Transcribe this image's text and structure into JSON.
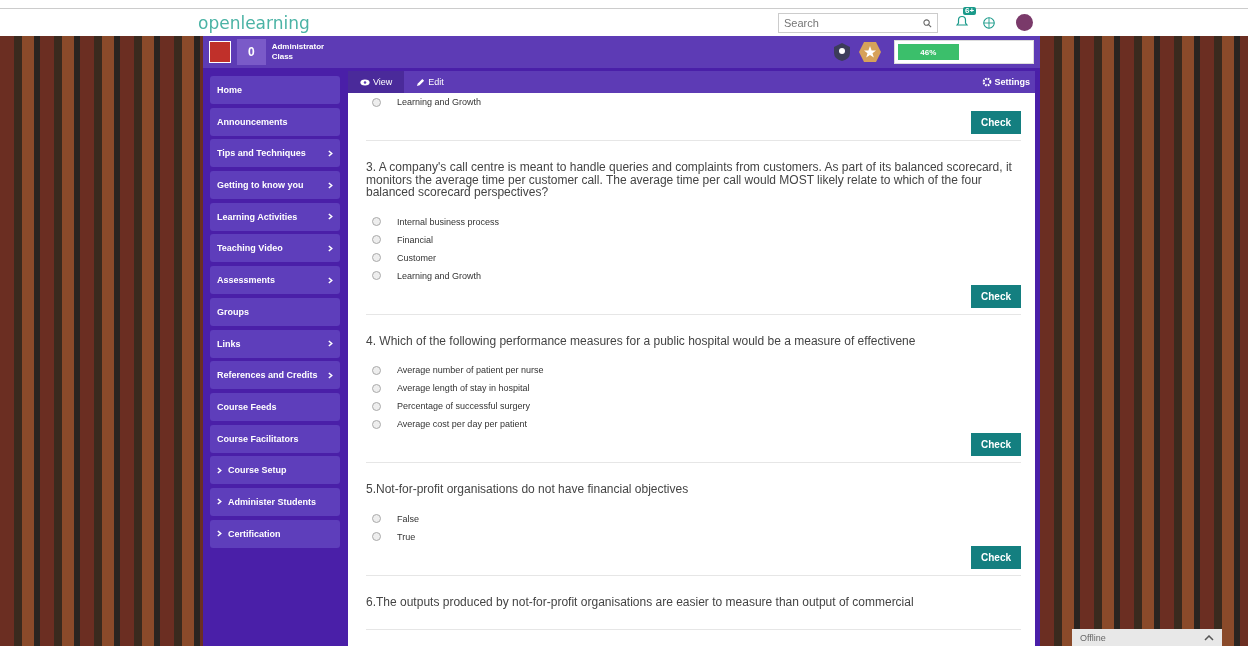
{
  "topbar": {
    "logo": "openlearning",
    "search": {
      "placeholder": "Search"
    },
    "notification_badge": "6+"
  },
  "course_header": {
    "points": "0",
    "role": "Administrator Class",
    "progress": {
      "level": 0.46,
      "label": "46%"
    }
  },
  "sidebar": {
    "items": [
      {
        "label": "Home",
        "expandable": false,
        "collapsible": false
      },
      {
        "label": "Announcements",
        "expandable": false,
        "collapsible": false
      },
      {
        "label": "Tips and Techniques",
        "expandable": true,
        "collapsible": false
      },
      {
        "label": "Getting to know you",
        "expandable": true,
        "collapsible": false
      },
      {
        "label": "Learning Activities",
        "expandable": true,
        "collapsible": false
      },
      {
        "label": "Teaching Video",
        "expandable": true,
        "collapsible": false
      },
      {
        "label": "Assessments",
        "expandable": true,
        "collapsible": false
      },
      {
        "label": "Groups",
        "expandable": false,
        "collapsible": false
      },
      {
        "label": "Links",
        "expandable": true,
        "collapsible": false
      },
      {
        "label": "References and Credits",
        "expandable": true,
        "collapsible": false
      },
      {
        "label": "Course Feeds",
        "expandable": false,
        "collapsible": false
      },
      {
        "label": "Course Facilitators",
        "expandable": false,
        "collapsible": false
      },
      {
        "label": "Course Setup",
        "expandable": false,
        "collapsible": true
      },
      {
        "label": "Administer Students",
        "expandable": false,
        "collapsible": true
      },
      {
        "label": "Certification",
        "expandable": false,
        "collapsible": true
      }
    ]
  },
  "tabs": [
    {
      "label": "View",
      "selected": true
    },
    {
      "label": "Edit",
      "selected": false
    }
  ],
  "settings": "Settings",
  "questions": [
    {
      "options": [
        {
          "label": "Learning and Growth",
          "selected": false
        }
      ],
      "button": "Check"
    },
    {
      "text": "3. A company's call centre is meant to handle queries and complaints from customers. As part of its balanced scorecard, it monitors the average time per customer call. The average time per call would MOST likely relate to which of the four balanced scorecard perspectives?",
      "options": [
        {
          "label": "Internal business process",
          "selected": false
        },
        {
          "label": "Financial",
          "selected": false
        },
        {
          "label": "Customer",
          "selected": false
        },
        {
          "label": "Learning and Growth",
          "selected": false
        }
      ],
      "button": "Check"
    },
    {
      "text": "4. Which of the following performance measures for a public hospital would be a measure of effectivene",
      "options": [
        {
          "label": "Average number of patient per nurse",
          "selected": false
        },
        {
          "label": "Average length of stay in hospital",
          "selected": false
        },
        {
          "label": "Percentage of successful surgery",
          "selected": false
        },
        {
          "label": "Average cost per day per patient",
          "selected": false
        }
      ],
      "button": "Check"
    },
    {
      "text": "5.Not-for-profit organisations do not have financial objectives",
      "options": [
        {
          "label": "False",
          "selected": false
        },
        {
          "label": "True",
          "selected": false
        }
      ],
      "button": "Check"
    },
    {
      "text": "6.The outputs produced by not-for-profit organisations are easier to measure than output of commercial"
    }
  ],
  "chat": {
    "status": "Offline"
  }
}
